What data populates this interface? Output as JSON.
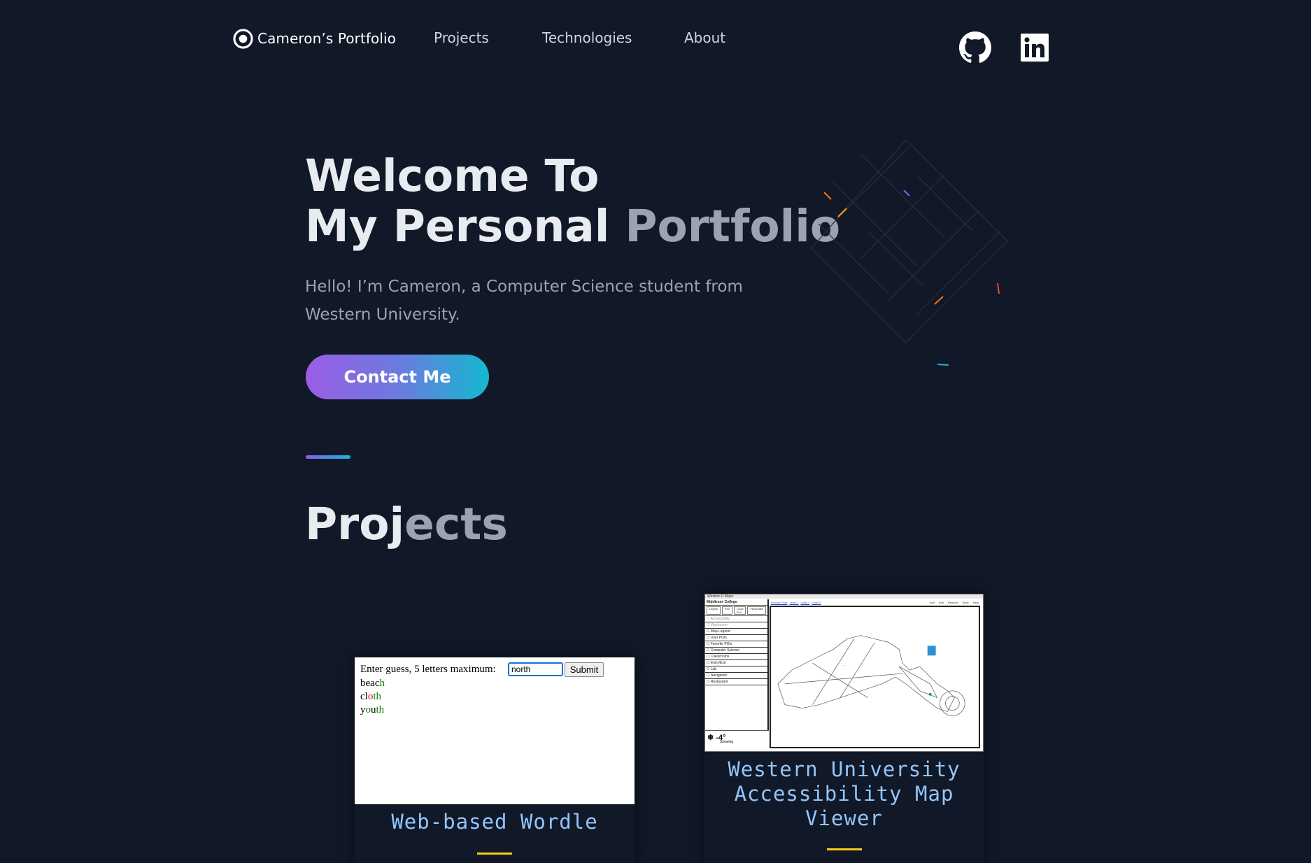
{
  "nav": {
    "brand": "Cameron’s Portfolio",
    "links": [
      "Projects",
      "Technologies",
      "About"
    ],
    "social": [
      {
        "icon": "github-icon"
      },
      {
        "icon": "linkedin-icon"
      }
    ]
  },
  "hero": {
    "title_line1": "Welcome To",
    "title_line2_part1": "My Personal ",
    "title_line2_part2": "Portfolio",
    "subtitle": "Hello! I’m Cameron, a Computer Science student from Western University.",
    "cta": "Contact Me"
  },
  "projects": {
    "title_part1": "Proj",
    "title_part2": "ects",
    "cards": [
      {
        "title": "Web-based Wordle",
        "shot": {
          "prompt": "Enter guess, 5 letters maximum:",
          "input_value": "north",
          "submit_label": "Submit",
          "guesses": [
            {
              "letters": [
                "b",
                "e",
                "a",
                "c",
                "h"
              ],
              "colors": [
                "black",
                "black",
                "black",
                "black",
                "green"
              ]
            },
            {
              "letters": [
                "c",
                "l",
                "o",
                "t",
                "h"
              ],
              "colors": [
                "black",
                "black",
                "red",
                "green",
                "green"
              ]
            },
            {
              "letters": [
                "y",
                "o",
                "u",
                "t",
                "h"
              ],
              "colors": [
                "black",
                "green",
                "black",
                "green",
                "green"
              ]
            }
          ]
        }
      },
      {
        "title": "Western University Accessibility Map Viewer",
        "shot": {
          "window_title": "Western U Maps",
          "building": "Middlesex College",
          "tabs": [
            "Layers",
            "POI",
            "Local POI",
            "Favourites"
          ],
          "toolbar_links": [
            "Ground Floor",
            "Level 2",
            "Level 3",
            "Level 4"
          ],
          "menu": [
            "Add",
            "Edit",
            "Remove",
            "Save",
            "Help"
          ],
          "layers": [
            "Accessibility",
            "Washroom",
            "Map Legend",
            "User POIs",
            "Favorite POIs",
            "Computer Science",
            "Classrooms",
            "Entry/Exit",
            "Lab",
            "Navigation",
            "Restaurant"
          ],
          "weather": "-4°",
          "weather_note": "Snowing"
        }
      }
    ]
  },
  "colors": {
    "background": "#111827",
    "accent_purple": "#9b5de5",
    "accent_cyan": "#14b8d0",
    "card_title": "#93c5fd",
    "underline": "#facc15"
  }
}
